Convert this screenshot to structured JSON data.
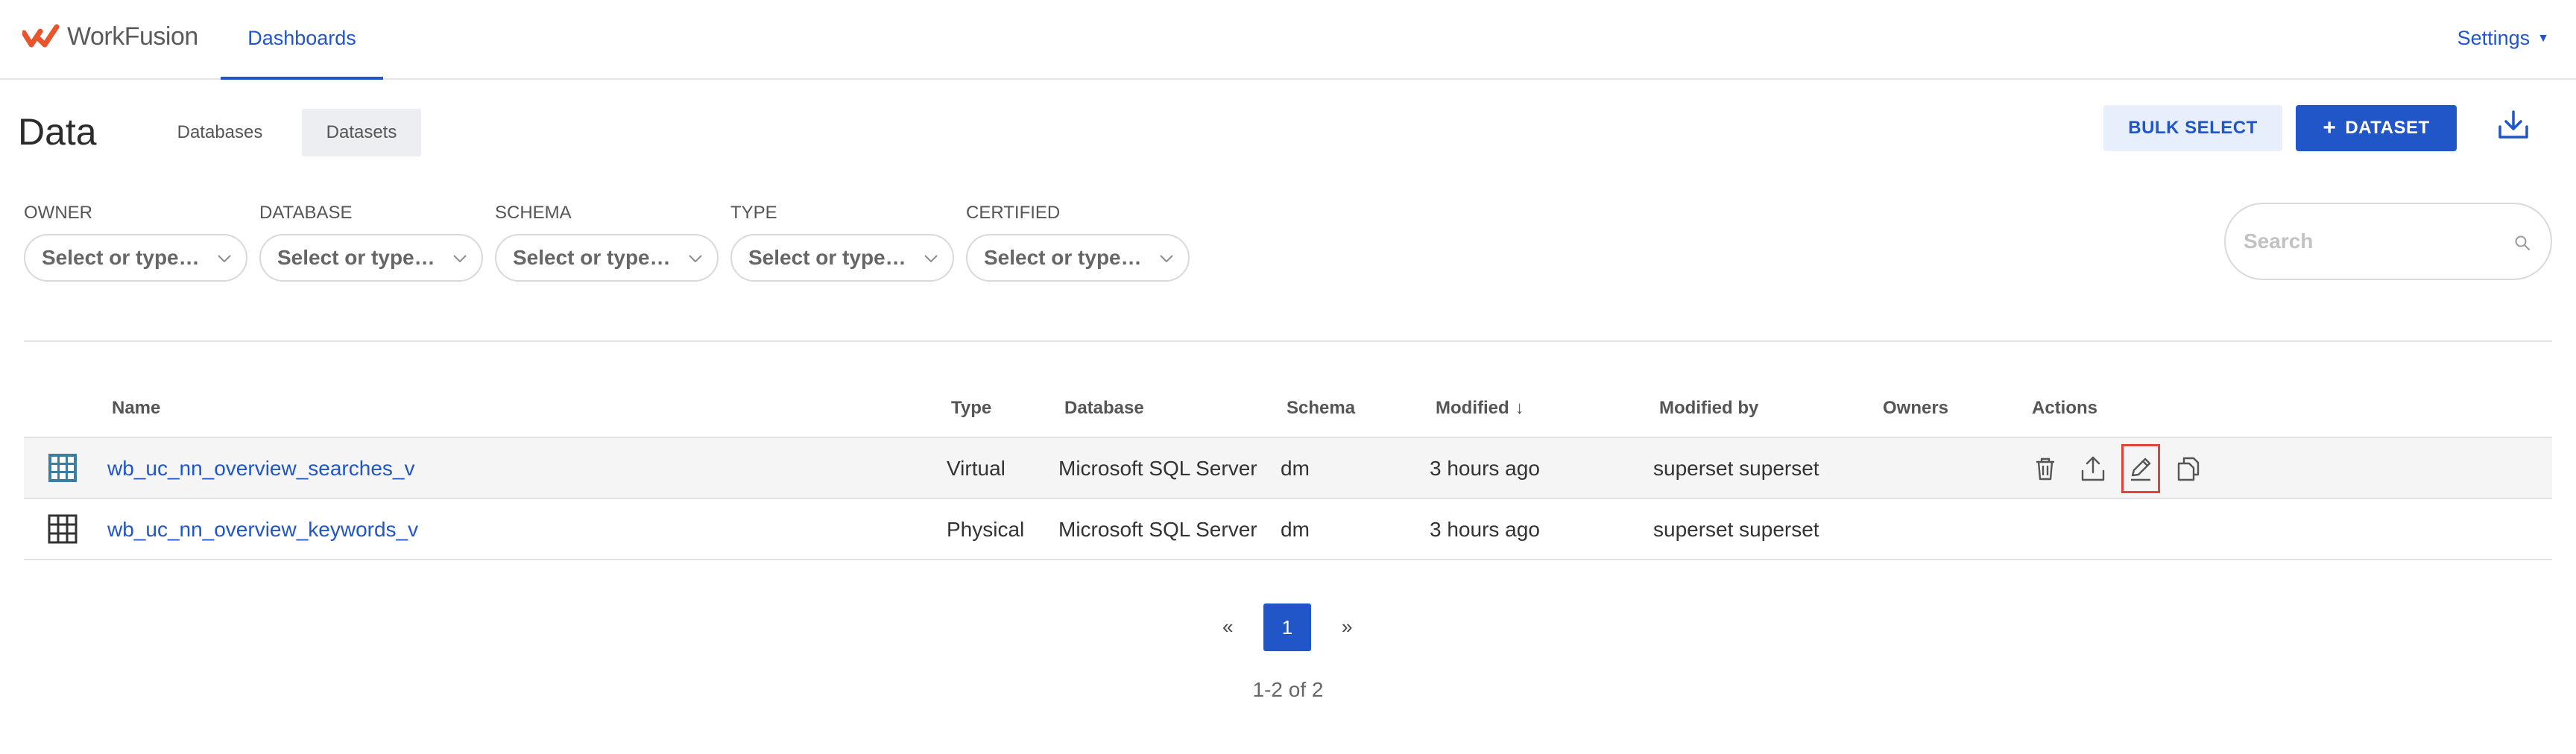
{
  "brand": {
    "name": "WorkFusion",
    "accent_color": "#e8542b"
  },
  "nav": {
    "active_tab": "Dashboards",
    "settings_label": "Settings"
  },
  "page": {
    "title": "Data",
    "subtabs": [
      "Databases",
      "Datasets"
    ],
    "active_subtab": "Datasets",
    "bulk_select_label": "BULK SELECT",
    "add_dataset_label": "DATASET",
    "download_icon": "download-icon"
  },
  "filters": [
    {
      "label": "OWNER",
      "placeholder": "Select or type…"
    },
    {
      "label": "DATABASE",
      "placeholder": "Select or type…"
    },
    {
      "label": "SCHEMA",
      "placeholder": "Select or type…"
    },
    {
      "label": "TYPE",
      "placeholder": "Select or type…"
    },
    {
      "label": "CERTIFIED",
      "placeholder": "Select or type…"
    }
  ],
  "search": {
    "placeholder": "Search"
  },
  "table": {
    "columns": {
      "name": "Name",
      "type": "Type",
      "database": "Database",
      "schema": "Schema",
      "modified": "Modified",
      "modified_by": "Modified by",
      "owners": "Owners",
      "actions": "Actions"
    },
    "sort_indicator": "↓",
    "rows": [
      {
        "name": "wb_uc_nn_overview_searches_v",
        "type": "Virtual",
        "database": "Microsoft SQL Server",
        "schema": "dm",
        "modified": "3 hours ago",
        "modified_by": "superset superset",
        "owners": "",
        "icon": "virtual-dataset-icon"
      },
      {
        "name": "wb_uc_nn_overview_keywords_v",
        "type": "Physical",
        "database": "Microsoft SQL Server",
        "schema": "dm",
        "modified": "3 hours ago",
        "modified_by": "superset superset",
        "owners": "",
        "icon": "physical-dataset-icon"
      }
    ],
    "row_actions": [
      "delete-icon",
      "export-icon",
      "edit-icon",
      "duplicate-icon"
    ]
  },
  "pagination": {
    "prev": "«",
    "current": "1",
    "next": "»",
    "summary": "1-2 of 2"
  },
  "colors": {
    "primary": "#2056c8",
    "primary_light": "#e8effc",
    "highlight_border": "#e0443a"
  }
}
